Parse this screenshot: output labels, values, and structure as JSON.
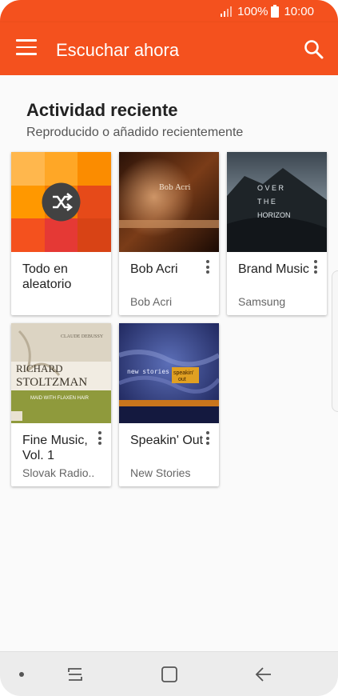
{
  "status": {
    "signal_icon": "signal-icon",
    "battery_pct": "100%",
    "battery_icon": "battery-icon",
    "time": "10:00"
  },
  "toolbar": {
    "title": "Escuchar ahora",
    "menu_icon": "menu-icon",
    "search_icon": "search-icon"
  },
  "recent": {
    "title": "Actividad reciente",
    "subtitle": "Reproducido o añadido recientemente",
    "cards": [
      {
        "name": "Todo en aleatorio",
        "artist": ""
      },
      {
        "name": "Bob Acri",
        "artist": "Bob Acri"
      },
      {
        "name": "Brand Music",
        "artist": "Samsung"
      },
      {
        "name": "Fine Music, Vol. 1",
        "artist": "Slovak Radio.."
      },
      {
        "name": "Speakin' Out",
        "artist": "New Stories"
      }
    ]
  },
  "album_art_text": {
    "bob_acri": "Bob Acri",
    "brand_music_line1": "O V E R",
    "brand_music_line2": "T H E",
    "brand_music_line3": "HORIZON",
    "fine_music_top": "CLAUDE DEBUSSY",
    "fine_music_name1": "RICHARD",
    "fine_music_name2": "STOLTZMAN",
    "fine_music_work": "MAID WITH FLAXEN HAIR",
    "speakin_line1": "new stories",
    "speakin_line2": "speakin'",
    "speakin_line3": "out"
  },
  "navigation": {
    "recents_icon": "recents-icon",
    "home_icon": "home-icon",
    "back_icon": "back-icon"
  },
  "colors": {
    "accent": "#f4511e"
  }
}
